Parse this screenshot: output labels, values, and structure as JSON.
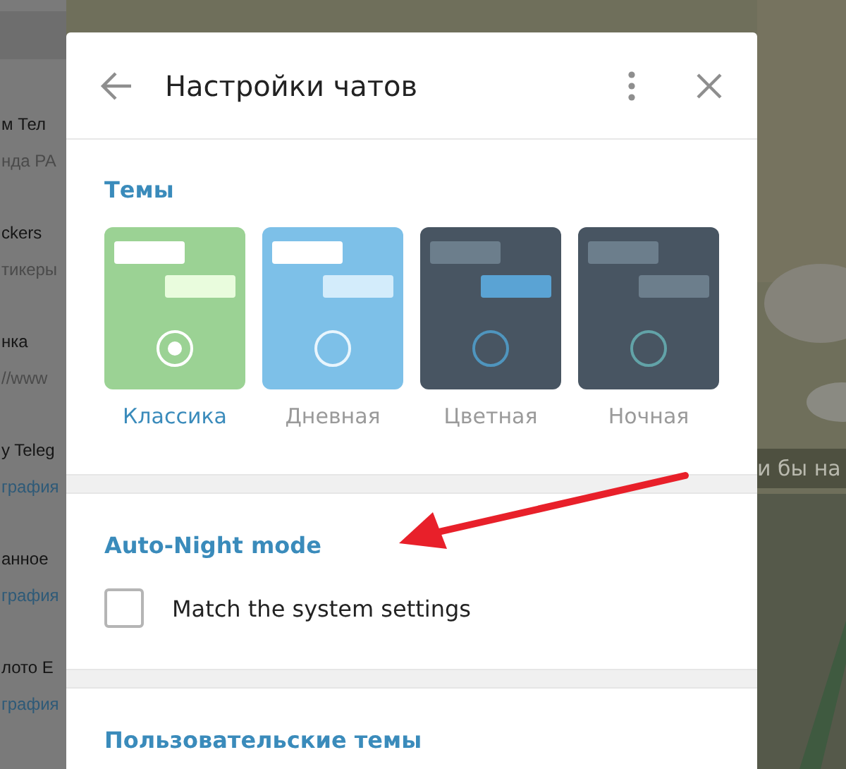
{
  "chat_list": [
    {
      "title": "м Тел",
      "preview": "нда РА",
      "accent": false
    },
    {
      "title": "ckers",
      "preview": "тикеры",
      "accent": false
    },
    {
      "title": "нка",
      "preview": "//www",
      "accent": false
    },
    {
      "title": "y Teleg",
      "preview": "графия",
      "accent": true
    },
    {
      "title": "анное",
      "preview": "графия",
      "accent": true
    },
    {
      "title": "лото Е",
      "preview": "графия",
      "accent": true
    }
  ],
  "background": {
    "kind": "picture",
    "caption": "и бы на"
  },
  "dialog": {
    "title": "Настройки чатов",
    "themes_section": {
      "heading": "Темы",
      "themes": [
        {
          "label": "Классика",
          "selected": true,
          "color": "#9bd294",
          "bubbles": [
            {
              "color": "#ffffff"
            },
            {
              "color": "#e9fcdd"
            }
          ],
          "radio": {
            "color": "#ffffff"
          }
        },
        {
          "label": "Дневная",
          "selected": false,
          "color": "#7dc0e8",
          "bubbles": [
            {
              "color": "#ffffff"
            },
            {
              "color": "#d3ecfb"
            }
          ],
          "radio": {
            "color": "#e8f5fd"
          }
        },
        {
          "label": "Цветная",
          "selected": false,
          "color": "#485562",
          "bubbles": [
            {
              "color": "#6c7e8c"
            },
            {
              "color": "#5aa3d4"
            }
          ],
          "radio": {
            "color": "#4f95be"
          }
        },
        {
          "label": "Ночная",
          "selected": false,
          "color": "#485562",
          "bubbles": [
            {
              "color": "#6c7e8c"
            },
            {
              "color": "#6c7e8c"
            }
          ],
          "radio": {
            "color": "#62a3a8"
          }
        }
      ]
    },
    "auto_night_section": {
      "heading": "Auto-Night mode",
      "option": {
        "label": "Match the system settings",
        "checked": false
      }
    },
    "custom_section": {
      "heading": "Пользовательские темы"
    }
  },
  "annotation": {
    "kind": "arrow"
  }
}
